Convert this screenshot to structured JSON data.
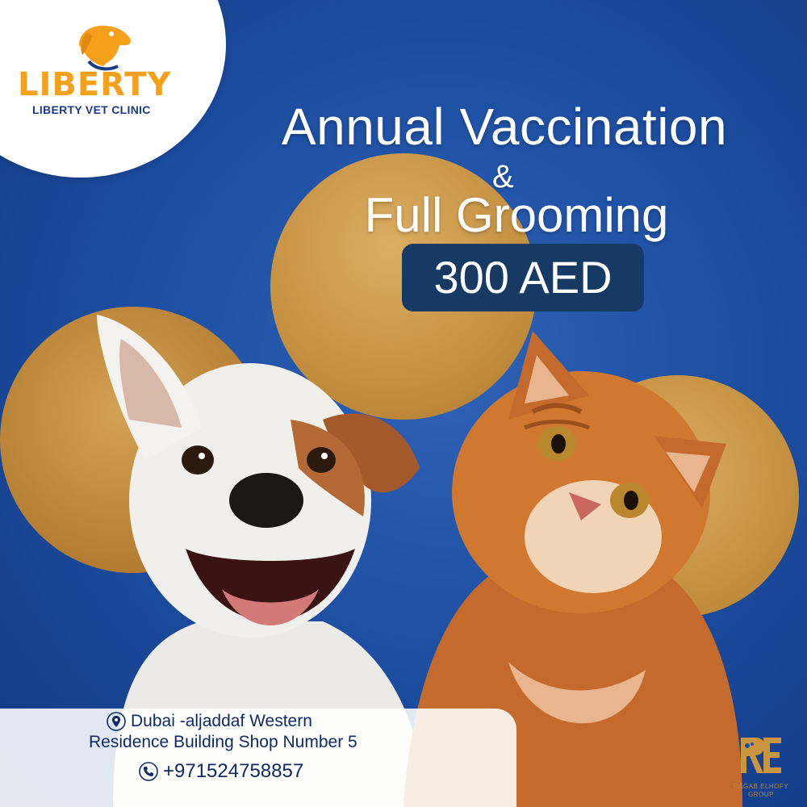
{
  "brand": {
    "logo_word": "LIBERTY",
    "logo_subtitle": "LIBERTY VET CLINIC",
    "logo_icon": "dog-head-icon",
    "accent_color": "#f4a01a",
    "brand_color": "#1a3a8a"
  },
  "headline": {
    "line_1": "Annual Vaccination",
    "ampersand": "&",
    "line_2": "Full Grooming"
  },
  "price": {
    "label": "300 AED"
  },
  "contact": {
    "address_line_1": "Dubai -aljaddaf Western",
    "address_line_2": "Residence Building Shop Number 5",
    "phone": "+971524758857",
    "location_icon": "location-pin-icon",
    "phone_icon": "phone-icon"
  },
  "maker": {
    "mark_letters": "RE",
    "caption": "RAGAB ELHOFY GROUP"
  },
  "colors": {
    "background": "#1d4fa3",
    "circles": "#c08b3b",
    "price_badge": "#163a63"
  }
}
